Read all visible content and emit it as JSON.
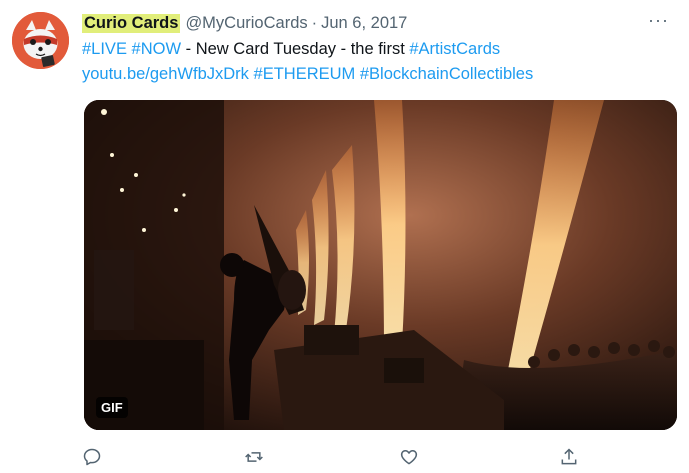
{
  "tweet": {
    "display_name": "Curio Cards",
    "handle": "@MyCurioCards",
    "separator": "·",
    "date": "Jun 6, 2017",
    "more": "···",
    "text": {
      "line1": [
        {
          "t": "#LIVE",
          "link": true
        },
        {
          "t": " ",
          "link": false
        },
        {
          "t": "#NOW",
          "link": true
        },
        {
          "t": " - New Card Tuesday - the first ",
          "link": false
        },
        {
          "t": "#ArtistCards",
          "link": true
        }
      ],
      "line2": [
        {
          "t": "youtu.be/gehWfbJxDrk",
          "link": true
        },
        {
          "t": " ",
          "link": false
        },
        {
          "t": "#ETHEREUM",
          "link": true
        },
        {
          "t": " ",
          "link": false
        },
        {
          "t": "#BlockchainCollectibles",
          "link": true
        }
      ]
    },
    "media": {
      "badge": "GIF"
    }
  },
  "actions": [
    "reply-icon",
    "retweet-icon",
    "like-icon",
    "share-icon"
  ],
  "colors": {
    "link": "#1d9bf0",
    "secondary": "#536471",
    "highlight": "#e1ee7a",
    "avatar_bg": "#e25a3a"
  }
}
